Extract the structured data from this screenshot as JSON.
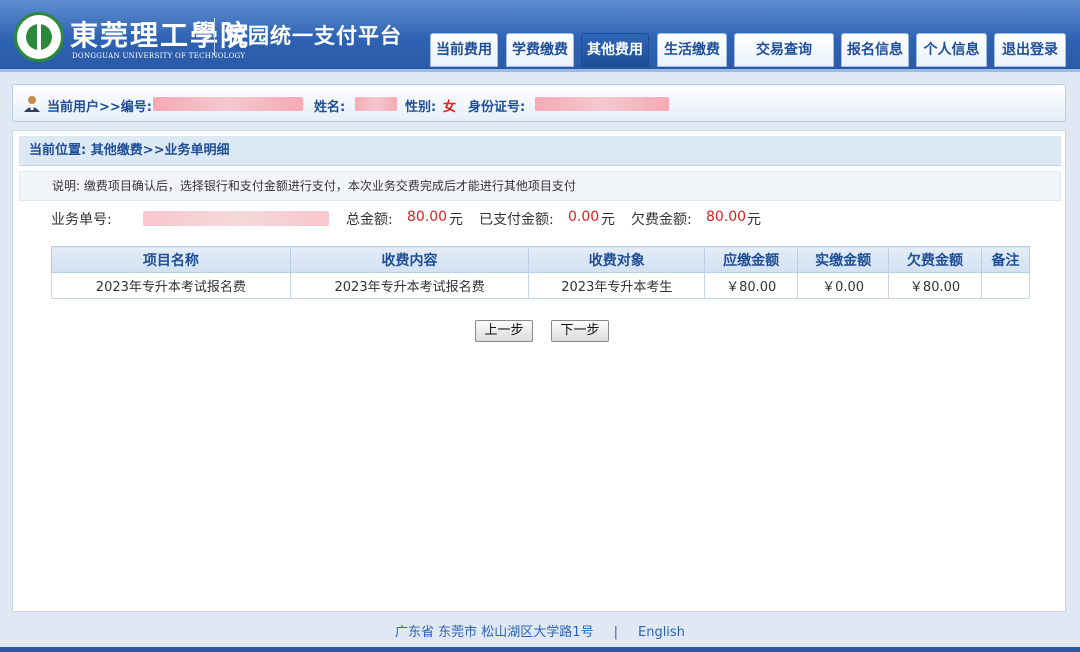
{
  "header": {
    "school_name": "東莞理工學院",
    "school_name_en": "DONGGUAN UNIVERSITY OF TECHNOLOGY",
    "platform_title": "校园统一支付平台",
    "nav": [
      {
        "label": "当前费用",
        "active": false
      },
      {
        "label": "学费缴费",
        "active": false
      },
      {
        "label": "其他费用",
        "active": true
      },
      {
        "label": "生活缴费",
        "active": false
      },
      {
        "label": "交易查询",
        "active": false
      },
      {
        "label": "报名信息",
        "active": false
      },
      {
        "label": "个人信息",
        "active": false
      },
      {
        "label": "退出登录",
        "active": false
      }
    ]
  },
  "userbar": {
    "current_user_label": "当前用户>>编号:",
    "name_label": "姓名:",
    "gender_label": "性别:",
    "gender_value": "女",
    "id_label": "身份证号:"
  },
  "breadcrumb": "当前位置: 其他缴费>>业务单明细",
  "notice": "说明: 缴费项目确认后，选择银行和支付金额进行支付，本次业务交费完成后才能进行其他项目支付",
  "summary": {
    "order_label": "业务单号:",
    "total_label": "总金额:",
    "total_value": "80.00",
    "paid_label": "已支付金额:",
    "paid_value": "0.00",
    "owed_label": "欠费金额:",
    "owed_value": "80.00",
    "unit": "元"
  },
  "table": {
    "headers": [
      "项目名称",
      "收费内容",
      "收费对象",
      "应缴金额",
      "实缴金额",
      "欠费金额",
      "备注"
    ],
    "rows": [
      [
        "2023年专升本考试报名费",
        "2023年专升本考试报名费",
        "2023年专升本考生",
        "￥80.00",
        "￥0.00",
        "￥80.00",
        ""
      ]
    ]
  },
  "buttons": {
    "prev": "上一步",
    "next": "下一步"
  },
  "footer": {
    "address": "广东省 东莞市 松山湖区大学路1号",
    "separator": "|",
    "english": "English"
  }
}
